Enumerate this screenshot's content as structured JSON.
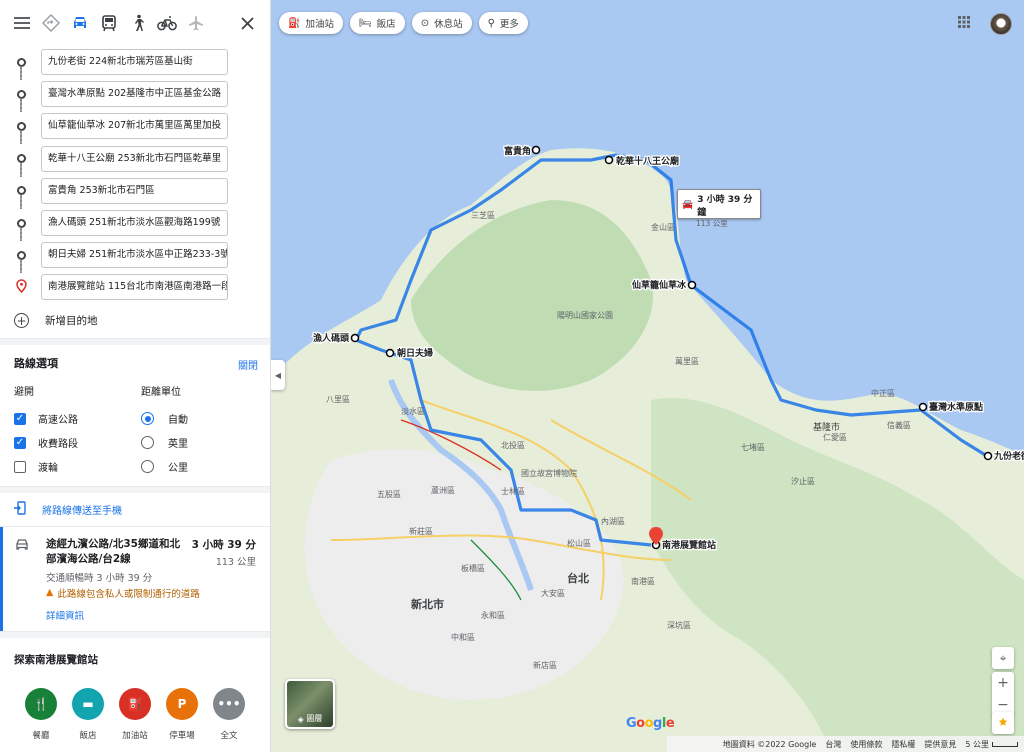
{
  "topbar": {
    "menu_icon": "menu-icon",
    "modes": [
      "directions-icon",
      "car-icon",
      "transit-icon",
      "walk-icon",
      "bike-icon",
      "flight-icon"
    ],
    "close_icon": "close-icon"
  },
  "stops": [
    "九份老街 224新北市瑞芳區基山街",
    "臺灣水準原點 202基隆市中正區基金公路",
    "仙草籠仙草冰 207新北市萬里區萬里加投",
    "乾華十八王公廟 253新北市石門區乾華里",
    "富貴角 253新北市石門區",
    "漁人碼頭 251新北市淡水區觀海路199號",
    "朝日夫婦 251新北市淡水區中正路233-3號",
    "南港展覽館站 115台北市南港區南港路一段"
  ],
  "add_destination": "新增目的地",
  "route_options": {
    "title": "路線選項",
    "close": "關閉",
    "avoid": {
      "heading": "避開",
      "items": [
        {
          "label": "高速公路",
          "checked": true
        },
        {
          "label": "收費路段",
          "checked": true
        },
        {
          "label": "渡輪",
          "checked": false
        }
      ]
    },
    "units": {
      "heading": "距離單位",
      "items": [
        {
          "label": "自動",
          "selected": true
        },
        {
          "label": "英里",
          "selected": false
        },
        {
          "label": "公里",
          "selected": false
        }
      ]
    }
  },
  "send_to_phone": "將路線傳送至手機",
  "route": {
    "via": "途經九濱公路/北35鄉道和北部濱海公路/台2線",
    "time": "3 小時 39 分",
    "distance": "113 公里",
    "traffic": "交通順暢時 3 小時 39 分",
    "warning": "此路線包含私人或限制通行的道路",
    "details": "詳細資訊"
  },
  "explore": {
    "title": "探索南港展覽館站",
    "categories": [
      {
        "label": "餐廳",
        "icon": "restaurant-icon",
        "color": "#188038",
        "glyph": "🍴"
      },
      {
        "label": "飯店",
        "icon": "hotel-icon",
        "color": "#12a4af",
        "glyph": "▬"
      },
      {
        "label": "加油站",
        "icon": "gas-station-icon",
        "color": "#d93025",
        "glyph": "⛽"
      },
      {
        "label": "停車場",
        "icon": "parking-icon",
        "color": "#e8710a",
        "glyph": "P"
      },
      {
        "label": "全文",
        "icon": "more-icon",
        "color": "#80868b",
        "glyph": "•••"
      }
    ]
  },
  "map": {
    "chips": [
      {
        "label": "加油站",
        "icon": "gas-station-icon"
      },
      {
        "label": "飯店",
        "icon": "hotel-icon"
      },
      {
        "label": "休息站",
        "icon": "rest-stop-icon"
      },
      {
        "label": "更多",
        "icon": "search-icon"
      }
    ],
    "duration_box": {
      "time": "3 小時 39 分鐘",
      "distance": "113 公里"
    },
    "places": [
      {
        "label": "富貴角"
      },
      {
        "label": "乾華十八王公廟"
      },
      {
        "label": "仙草籠仙草冰"
      },
      {
        "label": "漁人碼頭"
      },
      {
        "label": "朝日夫婦"
      },
      {
        "label": "臺灣水準原點"
      },
      {
        "label": "九份老街"
      },
      {
        "label": "南港展覽館站"
      }
    ],
    "area_labels": [
      "陽明山國家公園",
      "國立故宮博物院",
      "台北",
      "新北市",
      "基隆市",
      "淡水區",
      "八里區",
      "三芝區",
      "金山區",
      "萬里區",
      "中正區",
      "內湖區",
      "松山區",
      "大安區",
      "永和區",
      "南港區",
      "汐止區",
      "七堵區",
      "深坑區",
      "仁愛區",
      "信義區",
      "中和區",
      "五股區",
      "北投區",
      "士林區",
      "蘆洲區",
      "新莊區",
      "板橋區",
      "新店區"
    ],
    "layers_label": "圖層",
    "attribution": [
      "地圖資料 ©2022 Google",
      "台灣",
      "使用條款",
      "隱私權",
      "提供意見"
    ],
    "scale_label": "5 公里",
    "logo": [
      "G",
      "o",
      "o",
      "g",
      "l",
      "e"
    ]
  }
}
